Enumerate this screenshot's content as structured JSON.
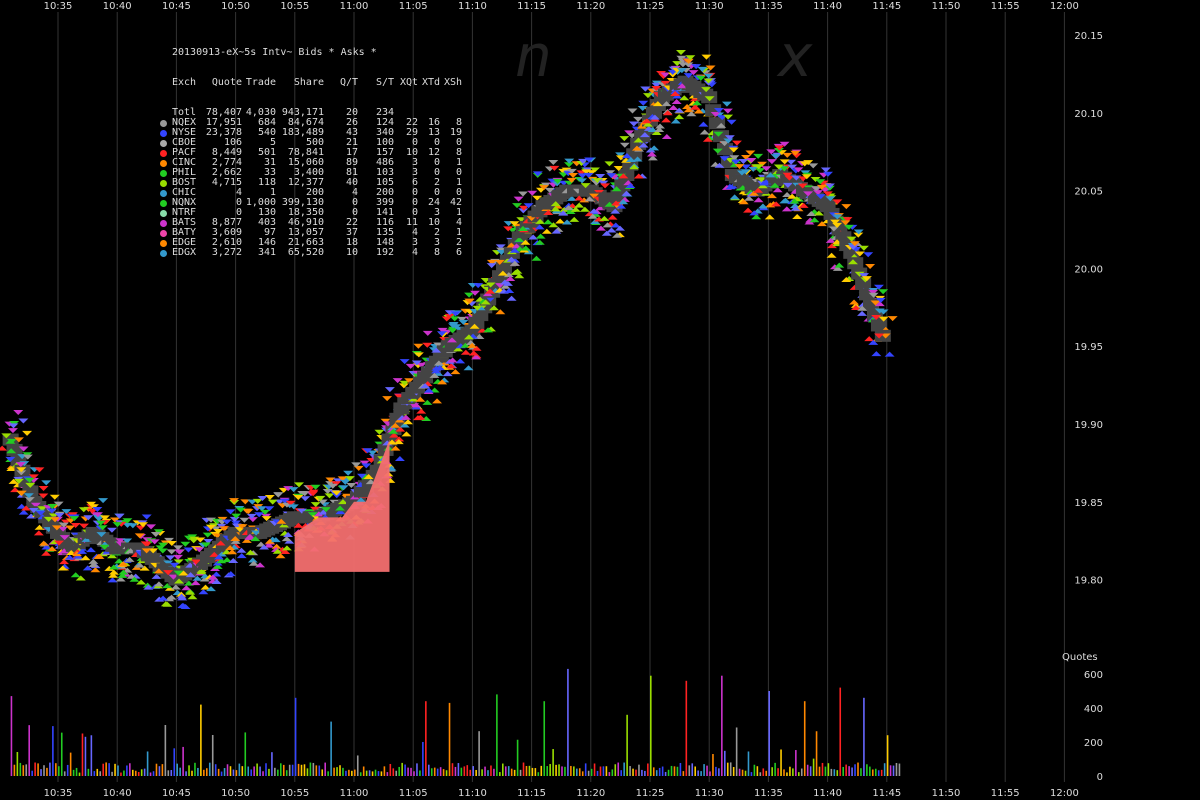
{
  "chart_data": [
    {
      "type": "scatter",
      "title": "20130913-eX~5s Intv~ Bids * Asks *",
      "x_ticks": [
        "10:35",
        "10:40",
        "10:45",
        "10:50",
        "10:55",
        "11:00",
        "11:05",
        "11:10",
        "11:15",
        "11:20",
        "11:25",
        "11:30",
        "11:35",
        "11:40",
        "11:45",
        "11:50",
        "11:55",
        "12:00"
      ],
      "y_ticks": [
        "20.15",
        "20.10",
        "20.05",
        "20.00",
        "19.95",
        "19.90",
        "19.85",
        "19.80"
      ],
      "ylim": [
        19.77,
        20.16
      ],
      "grid": "vertical",
      "series": [
        {
          "name": "Bids/Asks",
          "x": [
            "10:31",
            "10:33",
            "10:36",
            "10:38",
            "10:40",
            "10:42",
            "10:45",
            "10:47",
            "10:50",
            "10:52",
            "10:55",
            "10:57",
            "11:00",
            "11:02",
            "11:04",
            "11:06",
            "11:08",
            "11:10",
            "11:12",
            "11:14",
            "11:16",
            "11:18",
            "11:20",
            "11:22",
            "11:24",
            "11:26",
            "11:28",
            "11:30",
            "11:32",
            "11:34",
            "11:36",
            "11:38",
            "11:40",
            "11:42",
            "11:44",
            "11:45"
          ],
          "y": [
            19.89,
            19.85,
            19.82,
            19.83,
            19.82,
            19.82,
            19.8,
            19.81,
            19.83,
            19.83,
            19.84,
            19.84,
            19.85,
            19.87,
            19.91,
            19.93,
            19.95,
            19.96,
            19.99,
            20.02,
            20.04,
            20.05,
            20.05,
            20.04,
            20.08,
            20.11,
            20.12,
            20.11,
            20.06,
            20.05,
            20.06,
            20.05,
            20.04,
            20.01,
            19.97,
            19.95
          ]
        },
        {
          "name": "Trades",
          "x": [
            "10:55",
            "10:57",
            "10:59",
            "11:00",
            "11:01",
            "11:02",
            "11:03"
          ],
          "y": [
            19.83,
            19.84,
            19.84,
            19.85,
            19.85,
            19.87,
            19.89
          ]
        }
      ],
      "legend": {
        "header": [
          "Exch",
          "Quote",
          "Trade",
          "Share",
          "Q/T",
          "S/T",
          "XQt",
          "XTd",
          "XSh"
        ],
        "rows": [
          {
            "exch": "Totl",
            "quote": "78,407",
            "trade": "4,030",
            "share": "943,171",
            "qt": "20",
            "st": "234",
            "xqt": "",
            "xtd": "",
            "xsh": "",
            "color": ""
          },
          {
            "exch": "NQEX",
            "quote": "17,951",
            "trade": "684",
            "share": "84,674",
            "qt": "26",
            "st": "124",
            "xqt": "22",
            "xtd": "16",
            "xsh": "8",
            "color": "#999999"
          },
          {
            "exch": "NYSE",
            "quote": "23,378",
            "trade": "540",
            "share": "183,489",
            "qt": "43",
            "st": "340",
            "xqt": "29",
            "xtd": "13",
            "xsh": "19",
            "color": "#3344ff"
          },
          {
            "exch": "CBOE",
            "quote": "106",
            "trade": "5",
            "share": "500",
            "qt": "21",
            "st": "100",
            "xqt": "0",
            "xtd": "0",
            "xsh": "0",
            "color": "#aaaaaa"
          },
          {
            "exch": "PACF",
            "quote": "8,449",
            "trade": "501",
            "share": "78,841",
            "qt": "17",
            "st": "157",
            "xqt": "10",
            "xtd": "12",
            "xsh": "8",
            "color": "#ff2222"
          },
          {
            "exch": "CINC",
            "quote": "2,774",
            "trade": "31",
            "share": "15,060",
            "qt": "89",
            "st": "486",
            "xqt": "3",
            "xtd": "0",
            "xsh": "1",
            "color": "#ff8800"
          },
          {
            "exch": "PHIL",
            "quote": "2,662",
            "trade": "33",
            "share": "3,400",
            "qt": "81",
            "st": "103",
            "xqt": "3",
            "xtd": "0",
            "xsh": "0",
            "color": "#22cc22"
          },
          {
            "exch": "BOST",
            "quote": "4,715",
            "trade": "118",
            "share": "12,377",
            "qt": "40",
            "st": "105",
            "xqt": "6",
            "xtd": "2",
            "xsh": "1",
            "color": "#99dd00"
          },
          {
            "exch": "CHIC",
            "quote": "4",
            "trade": "1",
            "share": "200",
            "qt": "4",
            "st": "200",
            "xqt": "0",
            "xtd": "0",
            "xsh": "0",
            "color": "#3399cc"
          },
          {
            "exch": "NQNX",
            "quote": "0",
            "trade": "1,000",
            "share": "399,130",
            "qt": "0",
            "st": "399",
            "xqt": "0",
            "xtd": "24",
            "xsh": "42",
            "color": "#22cc22"
          },
          {
            "exch": "NTRF",
            "quote": "0",
            "trade": "130",
            "share": "18,350",
            "qt": "0",
            "st": "141",
            "xqt": "0",
            "xtd": "3",
            "xsh": "1",
            "color": "#88ddaa"
          },
          {
            "exch": "BATS",
            "quote": "8,877",
            "trade": "403",
            "share": "46,910",
            "qt": "22",
            "st": "116",
            "xqt": "11",
            "xtd": "10",
            "xsh": "4",
            "color": "#cc33cc"
          },
          {
            "exch": "BATY",
            "quote": "3,609",
            "trade": "97",
            "share": "13,057",
            "qt": "37",
            "st": "135",
            "xqt": "4",
            "xtd": "2",
            "xsh": "1",
            "color": "#ee44aa"
          },
          {
            "exch": "EDGE",
            "quote": "2,610",
            "trade": "146",
            "share": "21,663",
            "qt": "18",
            "st": "148",
            "xqt": "3",
            "xtd": "3",
            "xsh": "2",
            "color": "#ff8800"
          },
          {
            "exch": "EDGX",
            "quote": "3,272",
            "trade": "341",
            "share": "65,520",
            "qt": "10",
            "st": "192",
            "xqt": "4",
            "xtd": "8",
            "xsh": "6",
            "color": "#3399cc"
          }
        ]
      },
      "watermark": [
        "n",
        "x"
      ]
    },
    {
      "type": "bar",
      "title": "Quotes",
      "y_ticks": [
        "600",
        "400",
        "200",
        "0"
      ],
      "ylim": [
        0,
        650
      ],
      "peaks": [
        {
          "x": "10:31",
          "y": 470
        },
        {
          "x": "10:37",
          "y": 250
        },
        {
          "x": "10:44",
          "y": 300
        },
        {
          "x": "10:47",
          "y": 420
        },
        {
          "x": "10:55",
          "y": 460
        },
        {
          "x": "10:58",
          "y": 320
        },
        {
          "x": "11:06",
          "y": 440
        },
        {
          "x": "11:08",
          "y": 430
        },
        {
          "x": "11:12",
          "y": 480
        },
        {
          "x": "11:16",
          "y": 440
        },
        {
          "x": "11:18",
          "y": 630
        },
        {
          "x": "11:23",
          "y": 360
        },
        {
          "x": "11:25",
          "y": 590
        },
        {
          "x": "11:28",
          "y": 560
        },
        {
          "x": "11:31",
          "y": 590
        },
        {
          "x": "11:35",
          "y": 500
        },
        {
          "x": "11:38",
          "y": 440
        },
        {
          "x": "11:41",
          "y": 520
        },
        {
          "x": "11:43",
          "y": 460
        },
        {
          "x": "11:45",
          "y": 240
        }
      ]
    }
  ],
  "colors": {
    "trade_fill": "#f36f6f",
    "grid": "#333333",
    "box": "#444444",
    "quote_colors": [
      "#3344ff",
      "#22cc22",
      "#ffcc00",
      "#ff8800",
      "#ff2222",
      "#cc33cc",
      "#3399cc",
      "#99dd00",
      "#999999",
      "#6666ff"
    ]
  }
}
